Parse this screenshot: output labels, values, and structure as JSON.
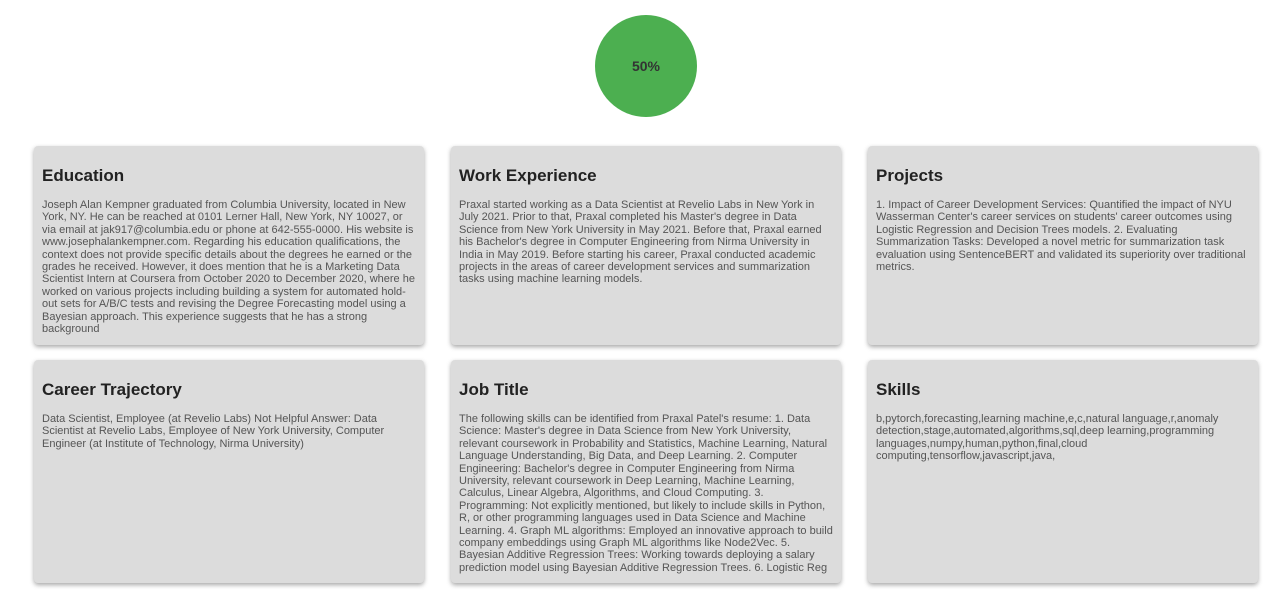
{
  "progress": {
    "label": "50%",
    "value": 0.5,
    "color": "#4caf50"
  },
  "cards": [
    {
      "title": "Education",
      "text": "Joseph Alan Kempner graduated from Columbia University, located in New York, NY. He can be reached at 0101 Lerner Hall, New York, NY 10027, or via email at jak917@columbia.edu or phone at 642-555-0000. His website is www.josephalankempner.com. Regarding his education qualifications, the context does not provide specific details about the degrees he earned or the grades he received. However, it does mention that he is a Marketing Data Scientist Intern at Coursera from October 2020 to December 2020, where he worked on various projects including building a system for automated hold-out sets for A/B/C tests and revising the Degree Forecasting model using a Bayesian approach. This experience suggests that he has a strong background"
    },
    {
      "title": "Work Experience",
      "text": "Praxal started working as a Data Scientist at Revelio Labs in New York in July 2021. Prior to that, Praxal completed his Master's degree in Data Science from New York University in May 2021. Before that, Praxal earned his Bachelor's degree in Computer Engineering from Nirma University in India in May 2019. Before starting his career, Praxal conducted academic projects in the areas of career development services and summarization tasks using machine learning models."
    },
    {
      "title": "Projects",
      "text": "1. Impact of Career Development Services: Quantified the impact of NYU Wasserman Center's career services on students' career outcomes using Logistic Regression and Decision Trees models. 2. Evaluating Summarization Tasks: Developed a novel metric for summarization task evaluation using SentenceBERT and validated its superiority over traditional metrics."
    },
    {
      "title": "Career Trajectory",
      "text": "Data Scientist, Employee (at Revelio Labs) Not Helpful Answer: Data Scientist at Revelio Labs, Employee of New York University, Computer Engineer (at Institute of Technology, Nirma University)"
    },
    {
      "title": "Job Title",
      "text": "The following skills can be identified from Praxal Patel's resume: 1. Data Science: Master's degree in Data Science from New York University, relevant coursework in Probability and Statistics, Machine Learning, Natural Language Understanding, Big Data, and Deep Learning. 2. Computer Engineering: Bachelor's degree in Computer Engineering from Nirma University, relevant coursework in Deep Learning, Machine Learning, Calculus, Linear Algebra, Algorithms, and Cloud Computing. 3. Programming: Not explicitly mentioned, but likely to include skills in Python, R, or other programming languages used in Data Science and Machine Learning. 4. Graph ML algorithms: Employed an innovative approach to build company embeddings using Graph ML algorithms like Node2Vec. 5. Bayesian Additive Regression Trees: Working towards deploying a salary prediction model using Bayesian Additive Regression Trees. 6. Logistic Reg"
    },
    {
      "title": "Skills",
      "text": "b,pytorch,forecasting,learning machine,e,c,natural language,r,anomaly detection,stage,automated,algorithms,sql,deep learning,programming languages,numpy,human,python,final,cloud computing,tensorflow,javascript,java,"
    }
  ]
}
